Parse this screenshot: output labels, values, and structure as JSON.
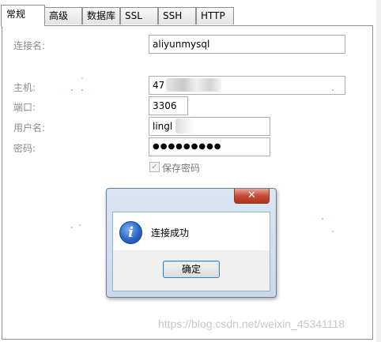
{
  "tabs": [
    "常规",
    "高级",
    "数据库",
    "SSL",
    "SSH",
    "HTTP"
  ],
  "form": {
    "connection_name": {
      "label": "连接名:",
      "value": "aliyunmysql"
    },
    "host": {
      "label": "主机:",
      "value": "47"
    },
    "port": {
      "label": "端口:",
      "value": "3306"
    },
    "username": {
      "label": "用户名:",
      "value": "lingl"
    },
    "password": {
      "label": "密码:",
      "value": "●●●●●●●●●"
    },
    "save_password": {
      "label": "保存密码",
      "checked": true
    }
  },
  "dialog": {
    "close_glyph": "✕",
    "icon": "info-icon",
    "message": "连接成功",
    "ok_label": "确定"
  },
  "watermark": "https://blog.csdn.net/weixin_45341118",
  "colors": {
    "dialog_frame": "#c9d8ea",
    "close_button": "#c64a33",
    "info_icon": "#2a66c9",
    "label_text": "#8b8b8b"
  }
}
